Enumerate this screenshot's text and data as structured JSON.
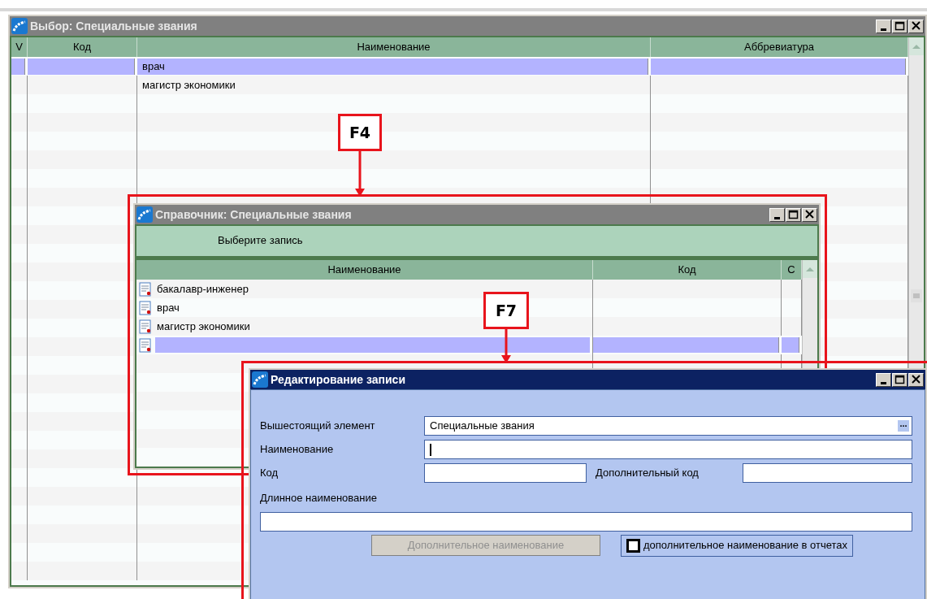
{
  "main_window": {
    "title": "Выбор: Специальные звания",
    "columns": [
      "V",
      "Код",
      "Наименование",
      "Аббревиатура"
    ],
    "rows": [
      {
        "name": "врач",
        "selected": true
      },
      {
        "name": "магистр экономики",
        "selected": false
      }
    ]
  },
  "callouts": [
    {
      "label": "F4"
    },
    {
      "label": "F7"
    }
  ],
  "directory_window": {
    "title": "Справочник: Специальные звания",
    "prompt": "Выберите запись",
    "columns": [
      "Наименование",
      "Код",
      "С"
    ],
    "rows": [
      {
        "name": "бакалавр-инженер",
        "selected": false
      },
      {
        "name": "врач",
        "selected": false
      },
      {
        "name": "магистр экономики",
        "selected": false
      },
      {
        "selected": true
      }
    ]
  },
  "edit_window": {
    "title": "Редактирование записи",
    "parent": {
      "label": "Вышестоящий элемент",
      "value": "Специальные звания",
      "browse": "..."
    },
    "name": {
      "label": "Наименование",
      "focused": true
    },
    "code": {
      "label": "Код"
    },
    "extra_code": {
      "label": "Дополнительный код"
    },
    "long_name": {
      "label": "Длинное наименование"
    },
    "extra_name_button": {
      "label": "Дополнительное наименование",
      "disabled": true
    },
    "reports_checkbox": {
      "label": "дополнительное наименование в отчетах",
      "checked": false
    }
  }
}
